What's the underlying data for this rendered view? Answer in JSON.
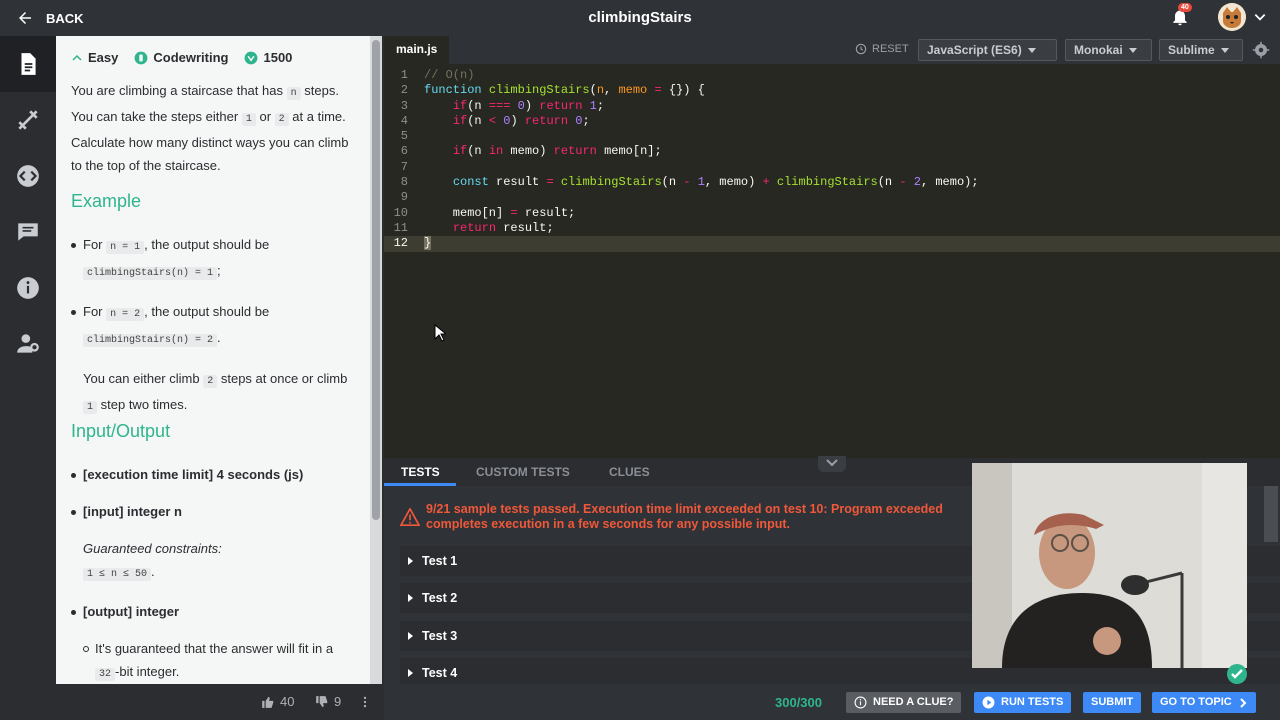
{
  "topbar": {
    "back_label": "BACK",
    "title": "climbingStairs",
    "notifications": "40"
  },
  "sidebar": {
    "items": [
      "description",
      "practice",
      "code",
      "comments",
      "info",
      "settings"
    ]
  },
  "description": {
    "difficulty": "Easy",
    "type": "Codewriting",
    "points": "1500",
    "intro_1": "You are climbing a staircase that has",
    "intro_n": "n",
    "intro_2": "steps. You can take the steps either",
    "intro_one": "1",
    "intro_or": "or",
    "intro_two": "2",
    "intro_3": "at a time. Calculate how many distinct ways you can climb to the top of the staircase.",
    "example_heading": "Example",
    "ex1_for": "For",
    "ex1_code": "n = 1",
    "ex1_text": ", the output should be",
    "ex1_result": "climbingStairs(n) = 1",
    "ex2_for": "For",
    "ex2_code": "n = 2",
    "ex2_text": ", the output should be",
    "ex2_result": "climbingStairs(n) = 2",
    "ex2_note_1": "You can either climb",
    "ex2_note_two": "2",
    "ex2_note_2": "steps at once or climb",
    "ex2_note_one": "1",
    "ex2_note_3": "step two times.",
    "io_heading": "Input/Output",
    "time_limit": "[execution time limit] 4 seconds (js)",
    "input": "[input] integer n",
    "constraints_label": "Guaranteed constraints:",
    "constraints": "1 ≤ n ≤ 50",
    "output": "[output] integer",
    "output_note_1": "It's guaranteed that the answer will fit in a",
    "output_note_32": "32",
    "output_note_2": "-bit integer."
  },
  "footer": {
    "likes": "40",
    "dislikes": "9"
  },
  "editor": {
    "tab": "main.js",
    "reset": "RESET",
    "language": "JavaScript (ES6)",
    "theme": "Monokai",
    "keymap": "Sublime"
  },
  "tests": {
    "tabs": [
      "TESTS",
      "CUSTOM TESTS",
      "CLUES"
    ],
    "error_line1": "9/21 sample tests passed. Execution time limit exceeded on test 10: Program exceeded",
    "error_line2": "completes execution in a few seconds for any possible input.",
    "items": [
      "Test 1",
      "Test 2",
      "Test 3",
      "Test 4"
    ]
  },
  "bottombar": {
    "score": "300/300",
    "clue": "NEED A CLUE?",
    "run": "RUN TESTS",
    "submit": "SUBMIT",
    "topic": "GO TO TOPIC"
  },
  "colors": {
    "accent_green": "#2fb58e",
    "error_red": "#f0583a",
    "primary_blue": "#3d8af7"
  }
}
